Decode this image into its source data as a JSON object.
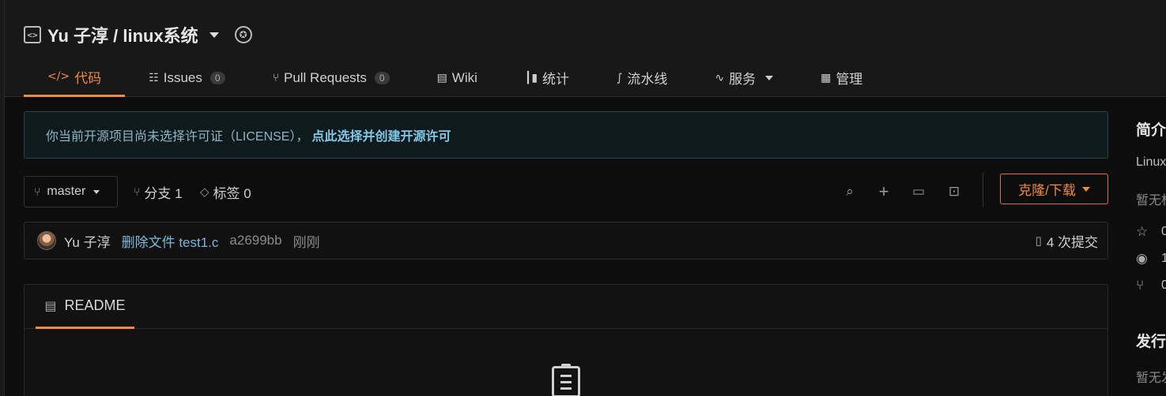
{
  "repo": {
    "title": "Yu 子淳 / linux系统"
  },
  "tabs": [
    {
      "label": "代码",
      "icon": "code-icon",
      "active": true
    },
    {
      "label": "Issues",
      "icon": "issues-icon",
      "count": "0"
    },
    {
      "label": "Pull Requests",
      "icon": "pull-request-icon",
      "count": "0"
    },
    {
      "label": "Wiki",
      "icon": "wiki-icon"
    },
    {
      "label": "统计",
      "icon": "stats-icon"
    },
    {
      "label": "流水线",
      "icon": "pipeline-icon"
    },
    {
      "label": "服务",
      "icon": "service-icon",
      "dropdown": true
    },
    {
      "label": "管理",
      "icon": "manage-icon"
    }
  ],
  "notice": {
    "text": "你当前开源项目尚未选择许可证（LICENSE），",
    "link": "点此选择并创建开源许可"
  },
  "branch": {
    "current": "master",
    "branches_label": "分支 1",
    "tags_label": "标签 0",
    "clone_label": "克隆/下载"
  },
  "commit": {
    "author": "Yu 子淳",
    "message": "删除文件 test1.c",
    "hash": "a2699bb",
    "time": "刚刚",
    "total": "4 次提交"
  },
  "readme": {
    "tab_label": "README"
  },
  "sidebar": {
    "intro_heading": "简介",
    "intro_text": "Linux",
    "intro_muted": "暂无标",
    "stars": "0",
    "watches": "1",
    "forks": "0",
    "release_heading": "发行",
    "release_muted": "暂无发"
  },
  "colors": {
    "accent": "#f08a3c",
    "link": "#7fc8e8",
    "background": "#0d0d0d"
  }
}
